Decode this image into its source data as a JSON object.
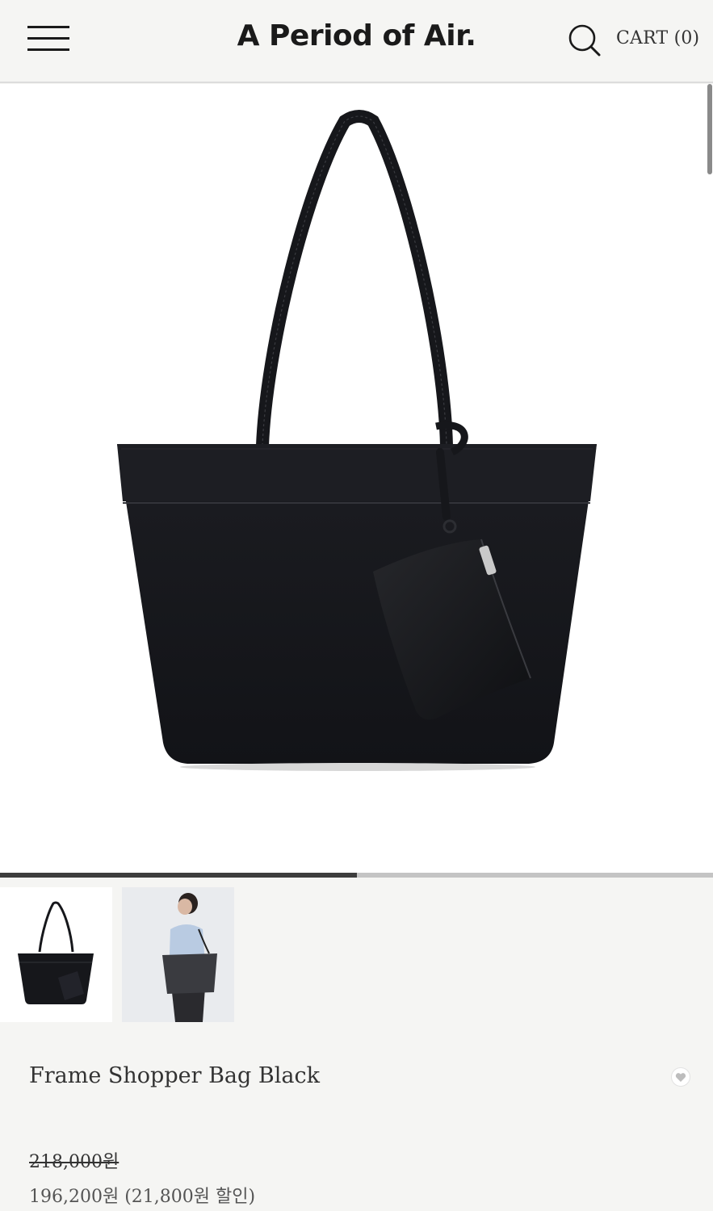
{
  "header": {
    "logo": "A Period of Air.",
    "menu_icon": "hamburger-menu-icon",
    "search_icon": "search-icon",
    "cart_label": "CART (0)"
  },
  "gallery": {
    "progress": 0.5,
    "thumbnails": [
      {
        "label": "product-photo",
        "selected": true
      },
      {
        "label": "model-photo",
        "selected": false
      }
    ]
  },
  "product": {
    "title": "Frame Shopper Bag Black",
    "price_original": "218,000원",
    "price_sale": "196,200원 (21,800원 할인)",
    "wish_icon": "heart-icon"
  },
  "colors": {
    "background": "#f5f5f3",
    "text": "#333333",
    "progress_fill": "#3d3d3d",
    "progress_track": "#c4c4c4"
  }
}
